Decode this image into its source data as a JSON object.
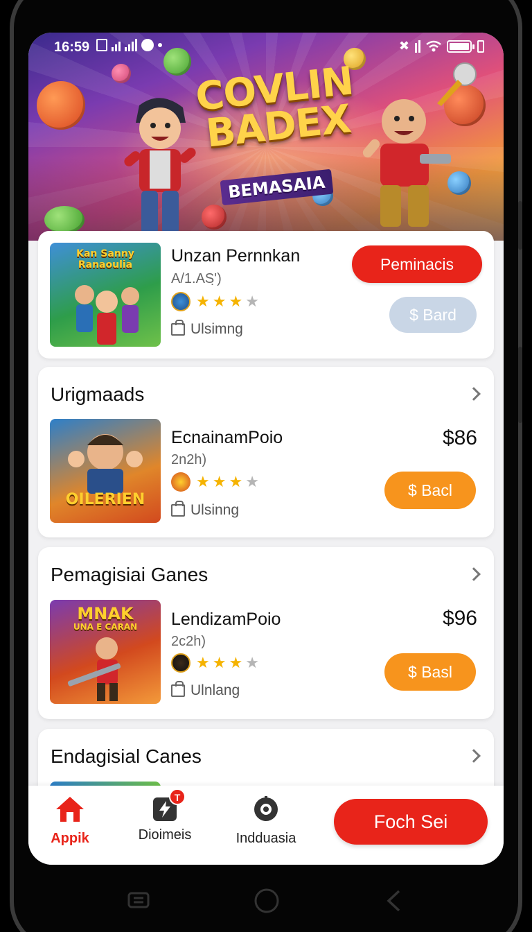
{
  "status_bar": {
    "time": "16:59"
  },
  "banner": {
    "title_line1": "COVLIN",
    "title_line2": "BADEX",
    "subtitle": "BEMASAIA"
  },
  "featured": {
    "thumb_title_line1": "Kan Sanny",
    "thumb_title_line2": "Ranaoulia",
    "name": "Unzan Pernnkan",
    "subtitle": "A/1.AS'̣)",
    "rating": 3,
    "rating_max": 4,
    "meta": "Ulsimng",
    "primary_button": "Peminacis",
    "secondary_button": "$ Bard"
  },
  "sections": [
    {
      "title": "Urigmaads",
      "item": {
        "thumb_title": "OILERIEN",
        "name": "EcnainamPoio",
        "subtitle": "2n2h)",
        "rating": 3,
        "rating_max": 4,
        "meta": "Ulsinng",
        "price": "$86",
        "button": "$ Bacl"
      }
    },
    {
      "title": "Pemagisiai Ganes",
      "item": {
        "thumb_title_line1": "MNAK",
        "thumb_title_line2": "UNA E CARAN",
        "name": "LendizamPoio",
        "subtitle": "2c2h)",
        "rating": 3,
        "rating_max": 4,
        "meta": "Ulnlang",
        "price": "$96",
        "button": "$ Basl"
      }
    },
    {
      "title": "Endagisial Canes"
    }
  ],
  "bottom_nav": {
    "items": [
      {
        "label": "Appik",
        "icon": "home-icon",
        "active": true
      },
      {
        "label": "Dioimeis",
        "icon": "lightning-icon",
        "badge": "T"
      },
      {
        "label": "Indduasia",
        "icon": "disc-icon"
      }
    ],
    "cta": "Foch Sei"
  },
  "colors": {
    "accent_red": "#e8241a",
    "accent_orange": "#f7941d",
    "star": "#f5b301",
    "disabled": "#c9d6e6"
  }
}
